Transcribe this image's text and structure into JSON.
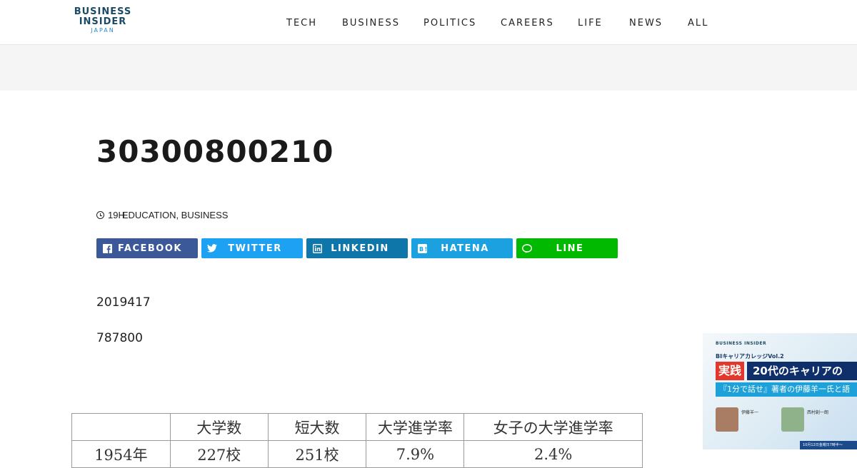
{
  "header": {
    "logo": {
      "line1": "BUSINESS",
      "line2": "INSIDER",
      "line3": "JAPAN"
    },
    "nav": [
      "TECH",
      "BUSINESS",
      "POLITICS",
      "CAREERS",
      "LIFE",
      "NEWS",
      "ALL"
    ]
  },
  "article": {
    "title": "30300800210",
    "meta": {
      "time": "19H",
      "categories": "EDUCATION, BUSINESS"
    },
    "share": {
      "facebook": "FACEBOOK",
      "twitter": "TWITTER",
      "linkedin": "LINKEDIN",
      "hatena": "HATENA",
      "line": "LINE"
    },
    "paragraphs": [
      "2019417",
      "787800"
    ],
    "table": {
      "headers": [
        "",
        "大学数",
        "短大数",
        "大学進学率",
        "女子の大学進学率"
      ],
      "row1": [
        "1954年",
        "227校",
        "251校",
        "7.9%",
        "2.4%"
      ]
    }
  },
  "ad": {
    "brand": "BUSINESS INSIDER",
    "subtitle": "BIキャリアカレッジVol.2",
    "tag": "実践",
    "headline": "20代のキャリアの",
    "subheadline": "『1分で話せ』著者の伊藤羊一氏と語",
    "person1": "伊藤羊一",
    "person2": "西村創一朗",
    "footer": "10月12日金曜日7時半〜"
  },
  "colors": {
    "facebook": "#3b5998",
    "twitter": "#1da1f2",
    "linkedin": "#0e76a8",
    "hatena": "#1ba1e0",
    "line": "#00b900",
    "logo": "#1b4a63"
  }
}
